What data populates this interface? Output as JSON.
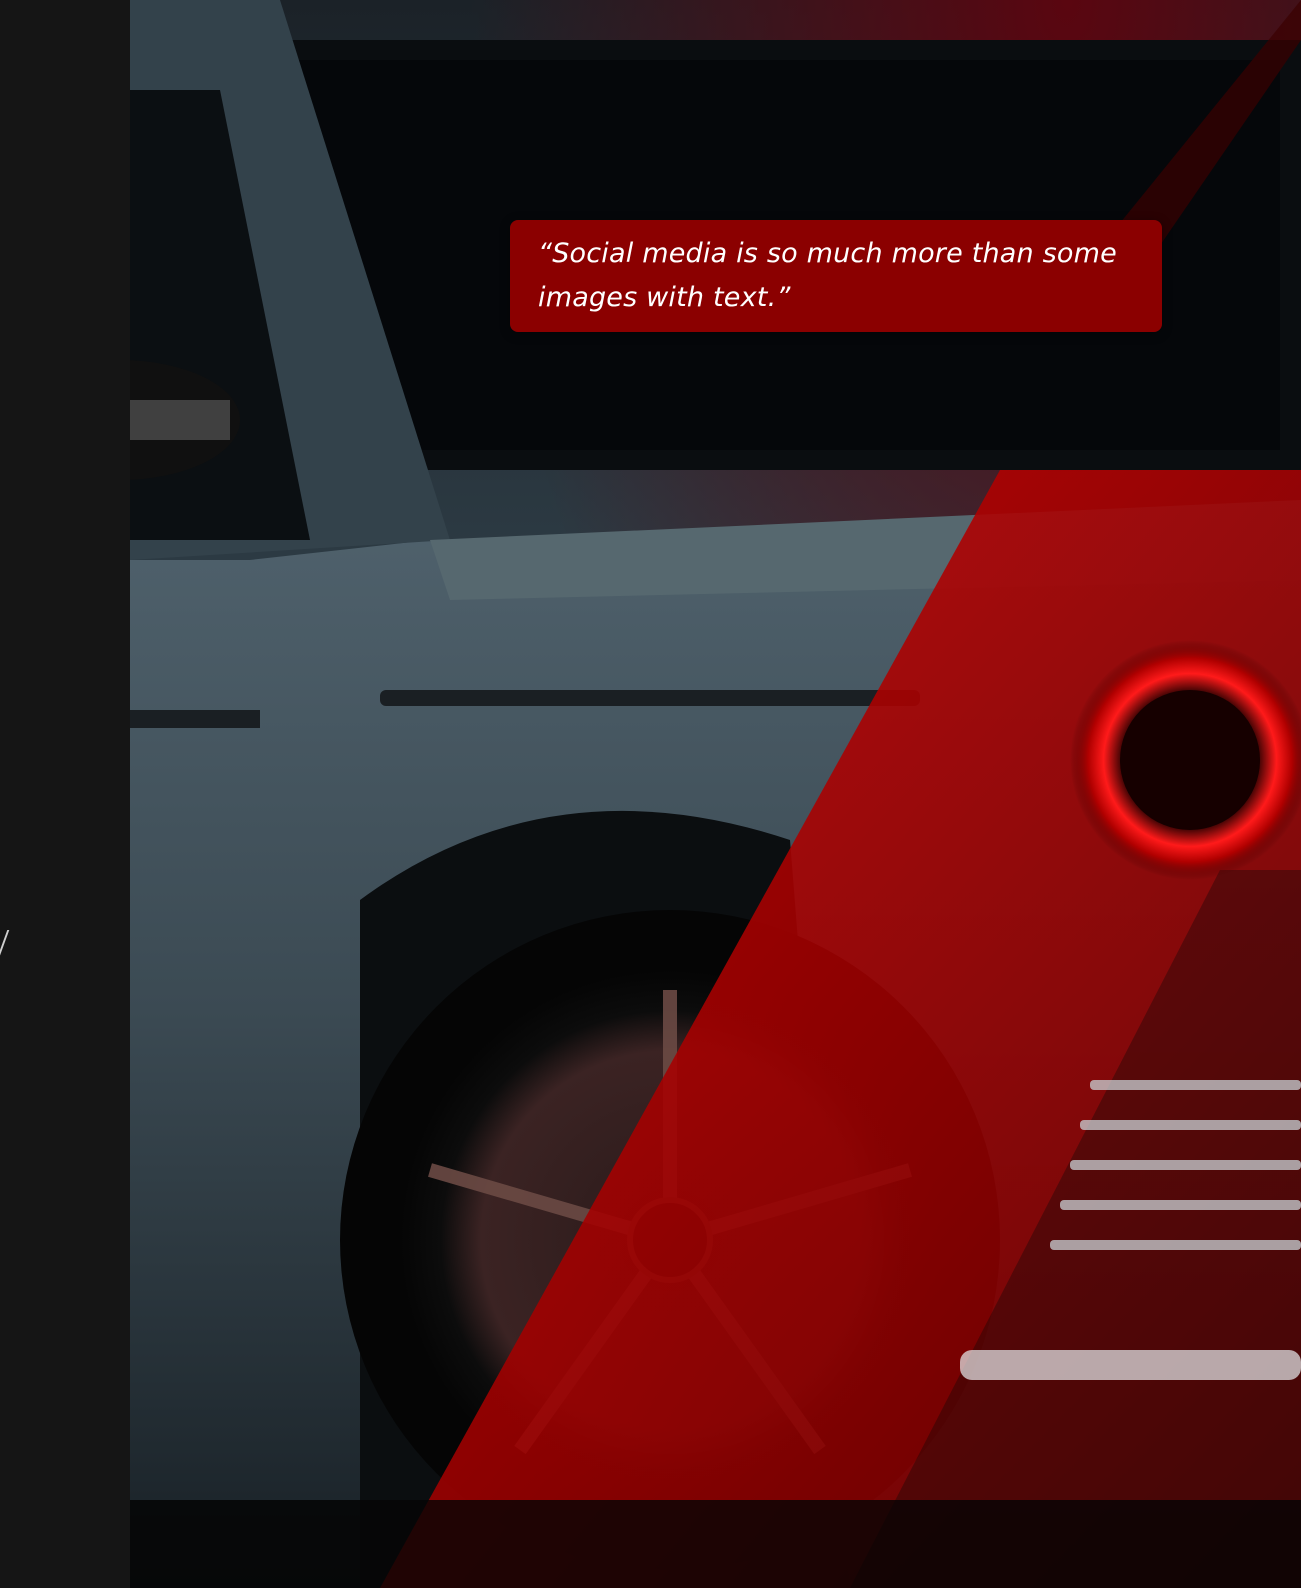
{
  "quote": {
    "text": "“Social media is so much more than some images with text.”"
  },
  "hero": {
    "subject": "dark-grey off-road SUV with red light overlay",
    "accent_color": "#8b0000",
    "glow_color": "#ff1010",
    "background_color": "#151515"
  }
}
